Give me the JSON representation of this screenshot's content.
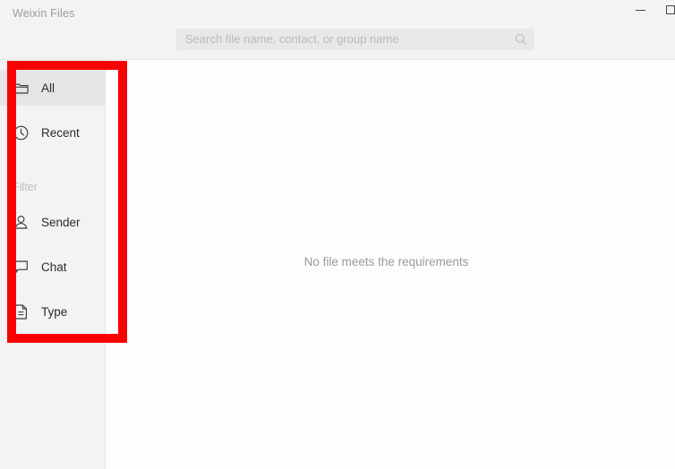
{
  "window": {
    "title": "Weixin Files",
    "controls": [
      {
        "name": "minimize",
        "label": "—"
      },
      {
        "name": "maximize",
        "label": "□"
      }
    ]
  },
  "search": {
    "placeholder": "Search file name, contact, or group name",
    "value": "",
    "icon": "search-icon"
  },
  "sidebar": {
    "items": [
      {
        "id": "all",
        "label": "All",
        "icon": "folder-icon",
        "selected": true
      },
      {
        "id": "recent",
        "label": "Recent",
        "icon": "clock-icon",
        "selected": false
      }
    ],
    "filter_heading": "Filter",
    "filter_items": [
      {
        "id": "sender",
        "label": "Sender",
        "icon": "person-icon",
        "selected": false
      },
      {
        "id": "chat",
        "label": "Chat",
        "icon": "chat-bubble-icon",
        "selected": false
      },
      {
        "id": "type",
        "label": "Type",
        "icon": "document-icon",
        "selected": false
      }
    ]
  },
  "main": {
    "empty_state_text": "No file meets the requirements"
  },
  "annotation": {
    "color": "#fb0000",
    "target": "sidebar-navigation"
  }
}
